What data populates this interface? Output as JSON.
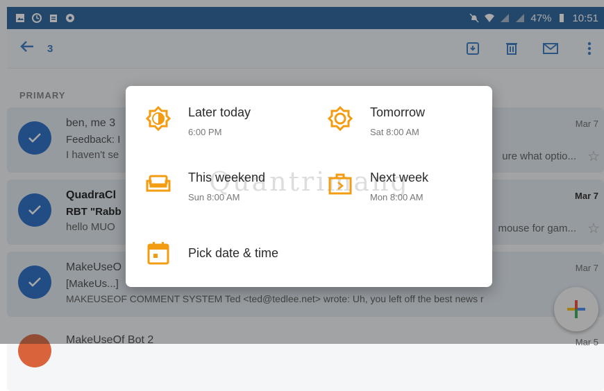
{
  "status_bar": {
    "battery": "47%",
    "time": "10:51"
  },
  "app_bar": {
    "selected_count": "3"
  },
  "inbox": {
    "section_label": "PRIMARY",
    "emails": [
      {
        "sender": "ben, me 3",
        "subject": "Feedback: I",
        "snippet": "I haven't se",
        "snippet_end": "ure what optio...",
        "date": "Mar 7"
      },
      {
        "sender": "QuadraCl",
        "subject": "RBT \"Rabb",
        "snippet": "hello MUO",
        "snippet_end": "mouse for gam...",
        "date": "Mar 7"
      },
      {
        "sender": "MakeUseO",
        "subject": "[MakeUs...]",
        "snippet": "MAKEUSEOF COMMENT SYSTEM Ted <ted@tedlee.net> wrote: Uh, you left off the best news r",
        "date": "Mar 7"
      },
      {
        "sender": "MakeUseOf Bot 2",
        "date": "Mar 5"
      }
    ]
  },
  "snooze_dialog": {
    "options": [
      {
        "label": "Later today",
        "time": "6:00 PM",
        "icon": "sun-half-icon"
      },
      {
        "label": "Tomorrow",
        "time": "Sat 8:00 AM",
        "icon": "sun-icon"
      },
      {
        "label": "This weekend",
        "time": "Sun 8:00 AM",
        "icon": "couch-icon"
      },
      {
        "label": "Next week",
        "time": "Mon 8:00 AM",
        "icon": "briefcase-icon"
      },
      {
        "label": "Pick date & time",
        "icon": "calendar-icon"
      }
    ]
  },
  "watermark": "Quantrimang",
  "colors": {
    "accent": "#f39c12",
    "blue": "#1f66c2",
    "status_bar": "#1f5d97"
  }
}
